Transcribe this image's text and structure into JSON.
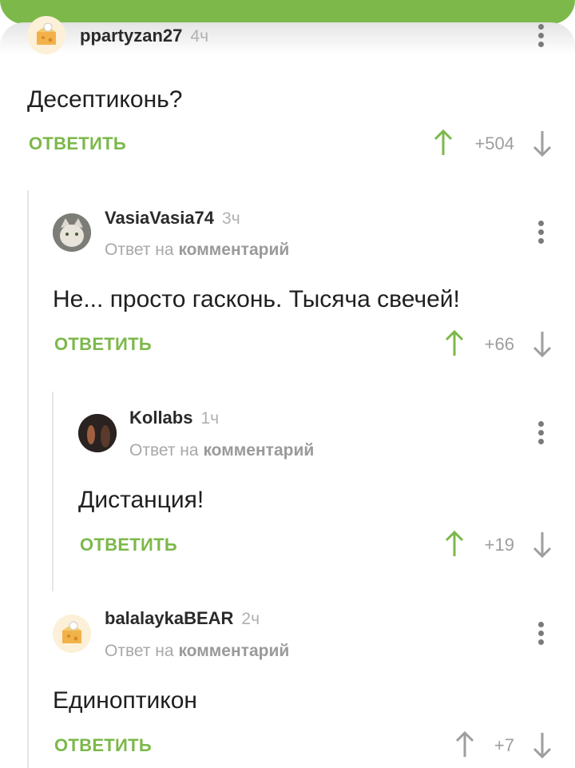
{
  "comments": [
    {
      "username": "ppartyzan27",
      "time": "4ч",
      "reply_to": "",
      "text": "Десептиконь?",
      "answer": "ОТВЕТИТЬ",
      "rating": "+504",
      "avatar": "cheese-avatar-icon"
    },
    {
      "username": "VasiaVasia74",
      "time": "3ч",
      "reply_prefix": "Ответ на",
      "reply_link": "комментарий",
      "text": "Не... просто гасконь. Тысяча свечей!",
      "answer": "ОТВЕТИТЬ",
      "rating": "+66",
      "avatar": "cat-avatar-icon"
    },
    {
      "username": "Kollabs",
      "time": "1ч",
      "reply_prefix": "Ответ на",
      "reply_link": "комментарий",
      "text": "Дистанция!",
      "answer": "ОТВЕТИТЬ",
      "rating": "+19",
      "avatar": "dark-avatar-icon"
    },
    {
      "username": "balalaykaBEAR",
      "time": "2ч",
      "reply_prefix": "Ответ на",
      "reply_link": "комментарий",
      "text": "Единоптикон",
      "answer": "ОТВЕТИТЬ",
      "rating": "+7",
      "avatar": "cheese-avatar-icon"
    }
  ],
  "colors": {
    "accent": "#7cb84a",
    "upvote_active": "#7cb84a",
    "downvote": "#9e9e9e"
  }
}
